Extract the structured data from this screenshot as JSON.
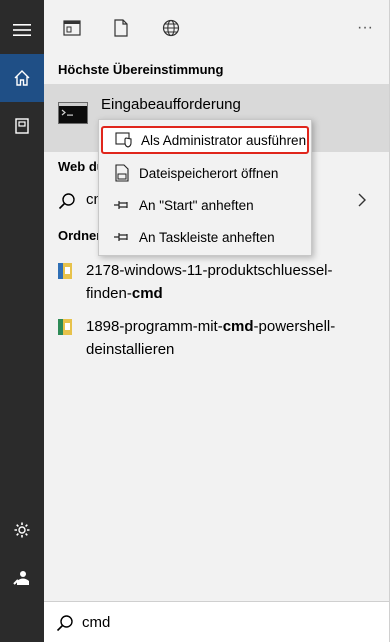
{
  "top_actions": {
    "apps_icon": "apps-filter-icon",
    "documents_icon": "documents-filter-icon",
    "web_icon": "web-filter-icon",
    "more": "···"
  },
  "rail": {
    "menu_icon": "hamburger-icon",
    "home_icon": "home-icon",
    "documents_icon": "document-icon",
    "settings_icon": "gear-icon",
    "user_icon": "user-icon"
  },
  "best_match": {
    "heading": "Höchste Übereinstimmung",
    "app_name": "Eingabeaufforderung"
  },
  "web": {
    "heading": "Web du",
    "query_prefix": "cn"
  },
  "folders": {
    "heading": "Ordner",
    "items": [
      {
        "line1": "2178-windows-11-produktschluessel-",
        "line2_prefix": "finden-",
        "line2_bold": "cmd",
        "line2_suffix": ""
      },
      {
        "line1_prefix": "1898-programm-mit-",
        "line1_bold": "cmd",
        "line1_suffix": "-powershell-",
        "line2": "deinstallieren"
      }
    ]
  },
  "context_menu": {
    "items": [
      {
        "label": "Als Administrator ausführen",
        "icon": "admin-shield-icon",
        "highlighted": true
      },
      {
        "label": "Dateispeicherort öffnen",
        "icon": "file-location-icon",
        "highlighted": false
      },
      {
        "label": "An \"Start\" anheften",
        "icon": "pin-icon",
        "highlighted": false
      },
      {
        "label": "An Taskleiste anheften",
        "icon": "pin-icon",
        "highlighted": false
      }
    ]
  },
  "search": {
    "value": "cmd"
  },
  "colors": {
    "rail_bg": "#2b2b2b",
    "rail_active": "#1f4f86",
    "panel_bg": "#f2f2f2",
    "highlight_border": "#e0261c"
  }
}
